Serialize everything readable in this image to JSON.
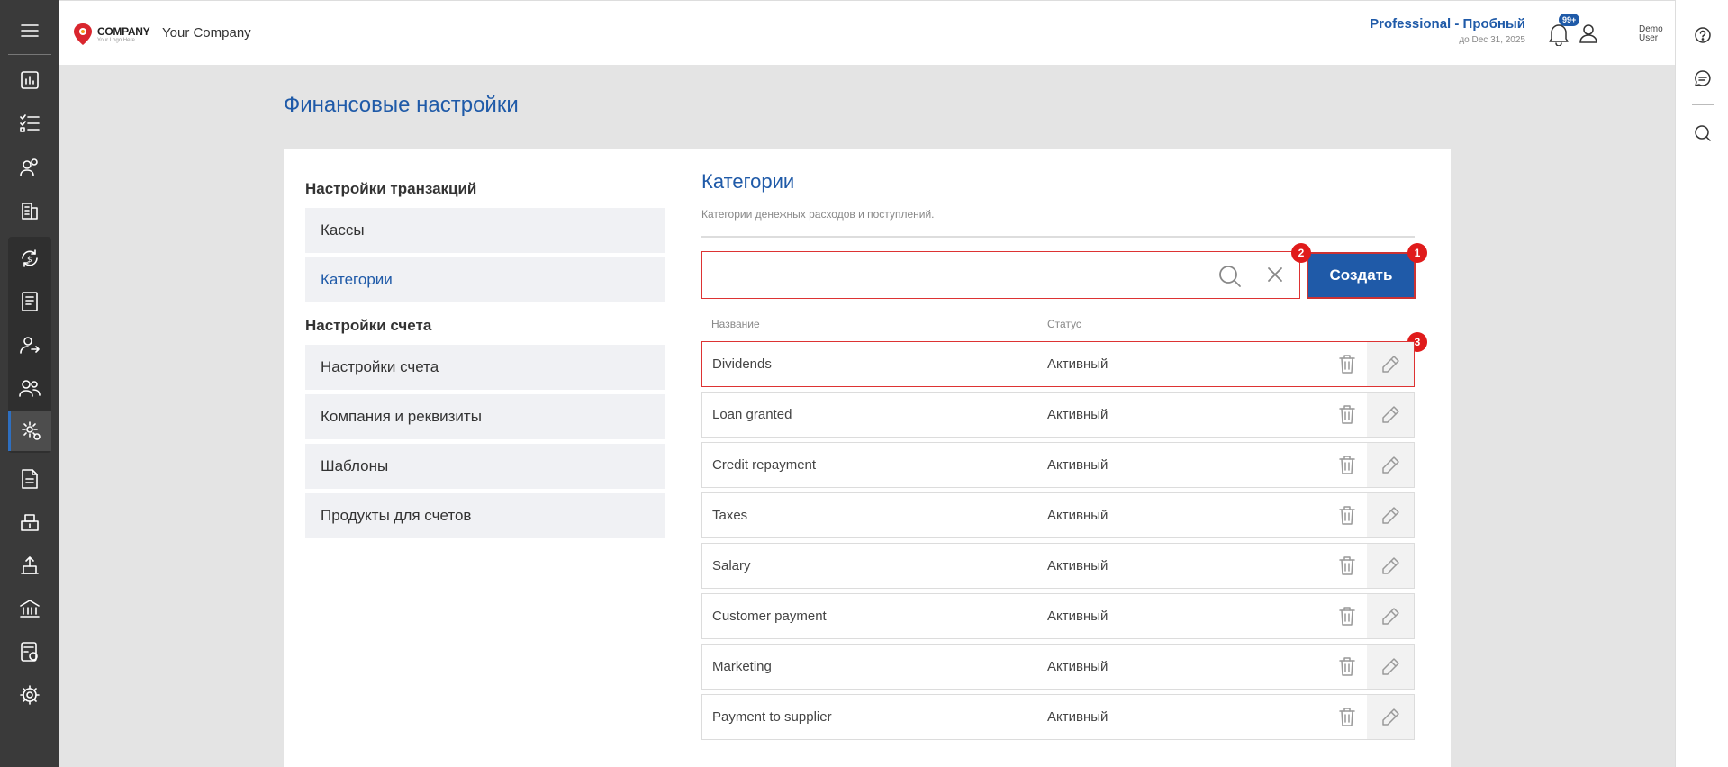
{
  "header": {
    "logo_main": "COMPANY",
    "logo_sub": "Your Logo Here",
    "company_name": "Your Company",
    "plan_name": "Professional - Пробный",
    "plan_date": "до Dec 31, 2025",
    "notifications_badge": "99+",
    "user_line1": "Demo",
    "user_line2": "User"
  },
  "page": {
    "title": "Финансовые настройки"
  },
  "sidebar": {
    "group1_heading": "Настройки транзакций",
    "group1_items": [
      {
        "label": "Кассы"
      },
      {
        "label": "Категории"
      }
    ],
    "group2_heading": "Настройки счета",
    "group2_items": [
      {
        "label": "Настройки счета"
      },
      {
        "label": "Компания и реквизиты"
      },
      {
        "label": "Шаблоны"
      },
      {
        "label": "Продукты для счетов"
      }
    ]
  },
  "section": {
    "title": "Категории",
    "description": "Категории денежных расходов и поступлений.",
    "search_value": "",
    "create_label": "Создать",
    "col_name": "Название",
    "col_status": "Статус"
  },
  "markers": [
    "1",
    "2",
    "3"
  ],
  "categories": [
    {
      "name": "Dividends",
      "status": "Активный"
    },
    {
      "name": "Loan granted",
      "status": "Активный"
    },
    {
      "name": "Credit repayment",
      "status": "Активный"
    },
    {
      "name": "Taxes",
      "status": "Активный"
    },
    {
      "name": "Salary",
      "status": "Активный"
    },
    {
      "name": "Customer payment",
      "status": "Активный"
    },
    {
      "name": "Marketing",
      "status": "Активный"
    },
    {
      "name": "Payment to supplier",
      "status": "Активный"
    }
  ],
  "nav_icons": [
    "menu-icon",
    "dashboard-icon",
    "tasks-icon",
    "contacts-icon",
    "companies-icon",
    "finance-icon",
    "invoices-icon",
    "client-icon",
    "team-icon",
    "settings-gear-icon",
    "documents-icon",
    "inventory-icon",
    "production-icon",
    "bank-icon",
    "calculator-icon",
    "settings-icon"
  ],
  "colors": {
    "accent": "#1f5aa8",
    "marker": "#e01b1b",
    "nav_bg": "#3a3a3a"
  }
}
